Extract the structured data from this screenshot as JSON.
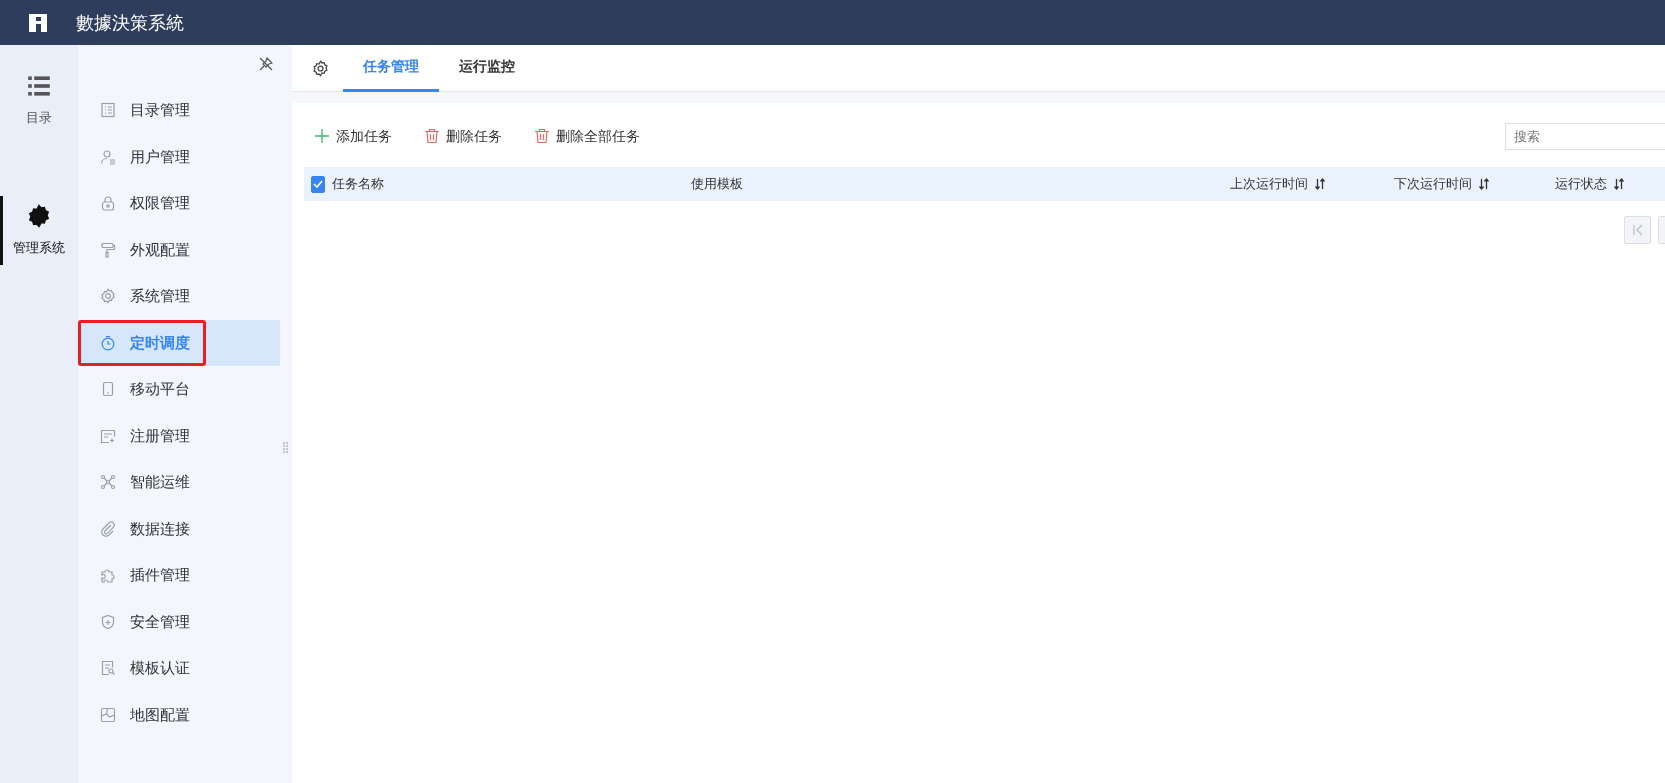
{
  "header": {
    "title": "數據決策系統"
  },
  "rail": [
    {
      "label": "目录",
      "selected": false
    },
    {
      "label": "管理系统",
      "selected": true
    }
  ],
  "sidebar": {
    "items": [
      {
        "label": "目录管理",
        "selected": false,
        "highlighted": false
      },
      {
        "label": "用户管理",
        "selected": false,
        "highlighted": false
      },
      {
        "label": "权限管理",
        "selected": false,
        "highlighted": false
      },
      {
        "label": "外观配置",
        "selected": false,
        "highlighted": false
      },
      {
        "label": "系统管理",
        "selected": false,
        "highlighted": false
      },
      {
        "label": "定时调度",
        "selected": true,
        "highlighted": true
      },
      {
        "label": "移动平台",
        "selected": false,
        "highlighted": false
      },
      {
        "label": "注册管理",
        "selected": false,
        "highlighted": false
      },
      {
        "label": "智能运维",
        "selected": false,
        "highlighted": false
      },
      {
        "label": "数据连接",
        "selected": false,
        "highlighted": false
      },
      {
        "label": "插件管理",
        "selected": false,
        "highlighted": false
      },
      {
        "label": "安全管理",
        "selected": false,
        "highlighted": false
      },
      {
        "label": "模板认证",
        "selected": false,
        "highlighted": false
      },
      {
        "label": "地图配置",
        "selected": false,
        "highlighted": false
      }
    ]
  },
  "tabs": [
    {
      "label": "任务管理",
      "selected": true
    },
    {
      "label": "运行监控",
      "selected": false
    }
  ],
  "toolbar": [
    {
      "label": "添加任务",
      "kind": "add"
    },
    {
      "label": "删除任务",
      "kind": "delete"
    },
    {
      "label": "删除全部任务",
      "kind": "delete"
    }
  ],
  "search": {
    "placeholder": "搜索"
  },
  "table": {
    "select_all_checked": true,
    "columns": [
      {
        "label": "任务名称",
        "sortable": false
      },
      {
        "label": "使用模板",
        "sortable": false
      },
      {
        "label": "上次运行时间",
        "sortable": true
      },
      {
        "label": "下次运行时间",
        "sortable": true
      },
      {
        "label": "运行状态",
        "sortable": true
      }
    ]
  }
}
